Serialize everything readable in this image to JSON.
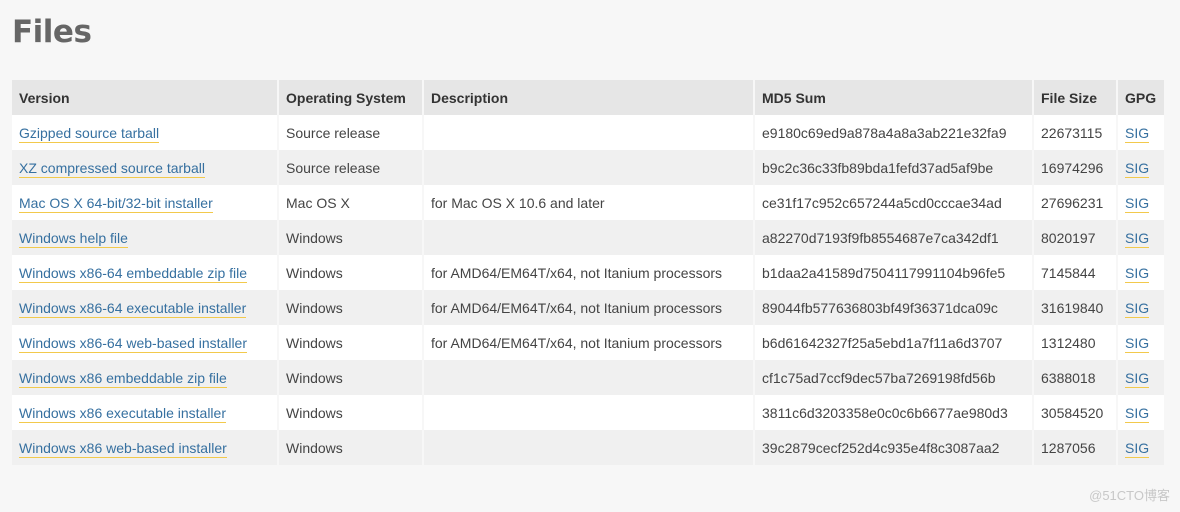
{
  "page": {
    "title": "Files"
  },
  "table": {
    "headers": [
      "Version",
      "Operating System",
      "Description",
      "MD5 Sum",
      "File Size",
      "GPG"
    ],
    "rows": [
      {
        "version": "Gzipped source tarball",
        "os": "Source release",
        "description": "",
        "md5": "e9180c69ed9a878a4a8a3ab221e32fa9",
        "size": "22673115",
        "gpg": "SIG"
      },
      {
        "version": "XZ compressed source tarball",
        "os": "Source release",
        "description": "",
        "md5": "b9c2c36c33fb89bda1fefd37ad5af9be",
        "size": "16974296",
        "gpg": "SIG"
      },
      {
        "version": "Mac OS X 64-bit/32-bit installer",
        "os": "Mac OS X",
        "description": "for Mac OS X 10.6 and later",
        "md5": "ce31f17c952c657244a5cd0cccae34ad",
        "size": "27696231",
        "gpg": "SIG"
      },
      {
        "version": "Windows help file",
        "os": "Windows",
        "description": "",
        "md5": "a82270d7193f9fb8554687e7ca342df1",
        "size": "8020197",
        "gpg": "SIG"
      },
      {
        "version": "Windows x86-64 embeddable zip file",
        "os": "Windows",
        "description": "for AMD64/EM64T/x64, not Itanium processors",
        "md5": "b1daa2a41589d7504117991104b96fe5",
        "size": "7145844",
        "gpg": "SIG"
      },
      {
        "version": "Windows x86-64 executable installer",
        "os": "Windows",
        "description": "for AMD64/EM64T/x64, not Itanium processors",
        "md5": "89044fb577636803bf49f36371dca09c",
        "size": "31619840",
        "gpg": "SIG"
      },
      {
        "version": "Windows x86-64 web-based installer",
        "os": "Windows",
        "description": "for AMD64/EM64T/x64, not Itanium processors",
        "md5": "b6d61642327f25a5ebd1a7f11a6d3707",
        "size": "1312480",
        "gpg": "SIG"
      },
      {
        "version": "Windows x86 embeddable zip file",
        "os": "Windows",
        "description": "",
        "md5": "cf1c75ad7ccf9dec57ba7269198fd56b",
        "size": "6388018",
        "gpg": "SIG"
      },
      {
        "version": "Windows x86 executable installer",
        "os": "Windows",
        "description": "",
        "md5": "3811c6d3203358e0c0c6b6677ae980d3",
        "size": "30584520",
        "gpg": "SIG"
      },
      {
        "version": "Windows x86 web-based installer",
        "os": "Windows",
        "description": "",
        "md5": "39c2879cecf252d4c935e4f8c3087aa2",
        "size": "1287056",
        "gpg": "SIG"
      }
    ]
  },
  "watermark": "@51CTO博客"
}
